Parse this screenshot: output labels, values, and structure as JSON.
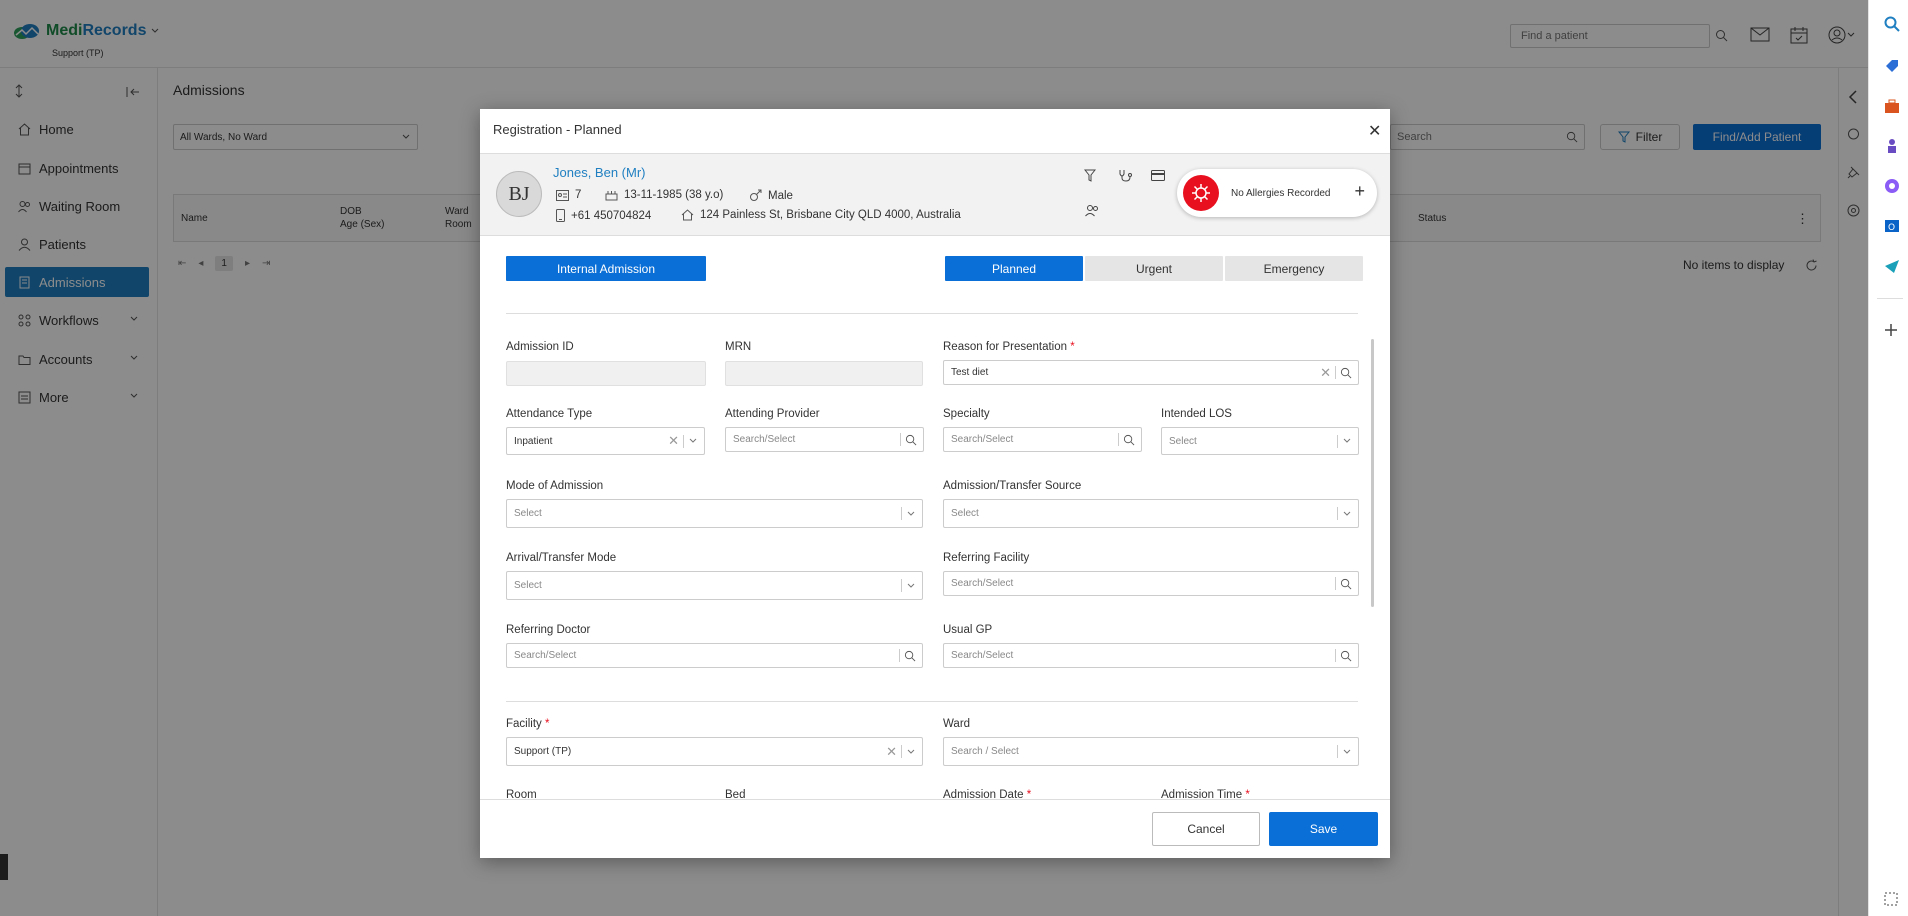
{
  "app": {
    "brand_left": "Medi",
    "brand_right": "Records",
    "org": "Support (TP)"
  },
  "topbar": {
    "find_patient_placeholder": "Find a patient"
  },
  "sidebar": {
    "items": [
      {
        "label": "Home",
        "icon": "home-icon"
      },
      {
        "label": "Appointments",
        "icon": "calendar-icon"
      },
      {
        "label": "Waiting Room",
        "icon": "people-icon"
      },
      {
        "label": "Patients",
        "icon": "user-icon"
      },
      {
        "label": "Admissions",
        "icon": "bed-icon",
        "active": true
      },
      {
        "label": "Workflows",
        "icon": "workflow-icon",
        "expandable": true
      },
      {
        "label": "Accounts",
        "icon": "folder-icon",
        "expandable": true
      },
      {
        "label": "More",
        "icon": "more-icon",
        "expandable": true
      }
    ]
  },
  "page": {
    "title": "Admissions",
    "ward_filter": "All Wards, No Ward",
    "search_placeholder": "Search",
    "filter_label": "Filter",
    "find_add_label": "Find/Add Patient",
    "grid_headers": {
      "name": "Name",
      "dob": "DOB",
      "age_sex": "Age (Sex)",
      "ward": "Ward",
      "room": "Room",
      "status": "Status"
    },
    "pager_page": "1",
    "no_items": "No items to display"
  },
  "modal": {
    "title": "Registration - Planned",
    "patient": {
      "initials": "BJ",
      "name": "Jones, Ben (Mr)",
      "id": "7",
      "dob": "13-11-1985 (38 y.o)",
      "sex": "Male",
      "phone": "+61 450704824",
      "address": "124 Painless St, Brisbane City QLD 4000, Australia"
    },
    "allergy_text": "No Allergies Recorded",
    "internal_admission": "Internal Admission",
    "priority": {
      "planned": "Planned",
      "urgent": "Urgent",
      "emergency": "Emergency"
    },
    "fields": {
      "admission_id": {
        "label": "Admission ID",
        "value": ""
      },
      "mrn": {
        "label": "MRN",
        "value": ""
      },
      "reason": {
        "label": "Reason for Presentation",
        "value": "Test diet"
      },
      "attendance_type": {
        "label": "Attendance Type",
        "value": "Inpatient"
      },
      "attending_provider": {
        "label": "Attending Provider",
        "placeholder": "Search/Select"
      },
      "specialty": {
        "label": "Specialty",
        "placeholder": "Search/Select"
      },
      "intended_los": {
        "label": "Intended LOS",
        "placeholder": "Select"
      },
      "mode_of_admission": {
        "label": "Mode of Admission",
        "placeholder": "Select"
      },
      "admission_source": {
        "label": "Admission/Transfer Source",
        "placeholder": "Select"
      },
      "arrival_mode": {
        "label": "Arrival/Transfer Mode",
        "placeholder": "Select"
      },
      "referring_facility": {
        "label": "Referring Facility",
        "placeholder": "Search/Select"
      },
      "referring_doctor": {
        "label": "Referring Doctor",
        "placeholder": "Search/Select"
      },
      "usual_gp": {
        "label": "Usual GP",
        "placeholder": "Search/Select"
      },
      "facility": {
        "label": "Facility",
        "value": "Support (TP)"
      },
      "ward": {
        "label": "Ward",
        "placeholder": "Search / Select"
      },
      "room": {
        "label": "Room"
      },
      "bed": {
        "label": "Bed"
      },
      "admission_date": {
        "label": "Admission Date"
      },
      "admission_time": {
        "label": "Admission Time"
      }
    },
    "required_mark": "*",
    "cancel": "Cancel",
    "save": "Save"
  },
  "colors": {
    "primary": "#0a6fd6",
    "active_nav": "#1f7fc1",
    "allergy": "#e8101f"
  }
}
